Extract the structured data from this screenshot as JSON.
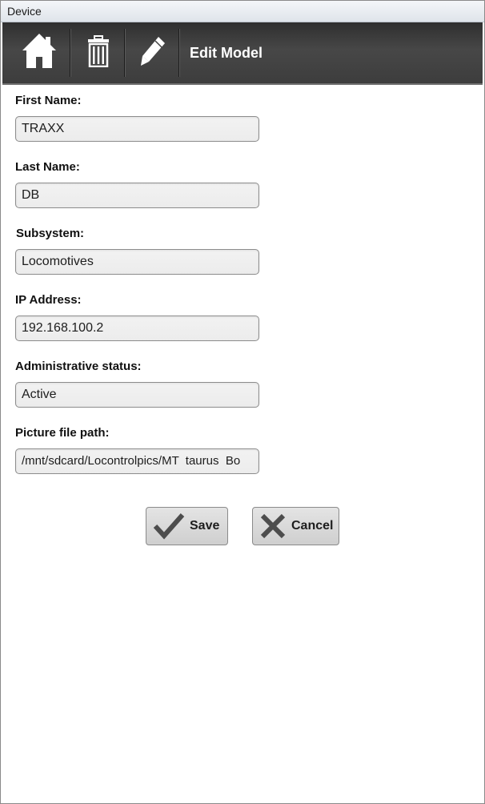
{
  "window": {
    "title": "Device"
  },
  "toolbar": {
    "icons": [
      "home-icon",
      "trash-icon",
      "pencil-icon"
    ],
    "title": "Edit Model"
  },
  "form": {
    "fields": [
      {
        "label": "First Name:",
        "value": "TRAXX"
      },
      {
        "label": "Last Name:",
        "value": "DB"
      },
      {
        "label": "Subsystem:",
        "value": "Locomotives"
      },
      {
        "label": "IP Address:",
        "value": "192.168.100.2"
      },
      {
        "label": "Administrative status:",
        "value": "Active"
      },
      {
        "label": "Picture file path:",
        "value": "/mnt/sdcard/Locontrolpics/MT  taurus  Bo"
      }
    ]
  },
  "actions": {
    "save_label": "Save",
    "cancel_label": "Cancel"
  },
  "colors": {
    "toolbar": "#404040",
    "field_bg": "#efefef"
  }
}
